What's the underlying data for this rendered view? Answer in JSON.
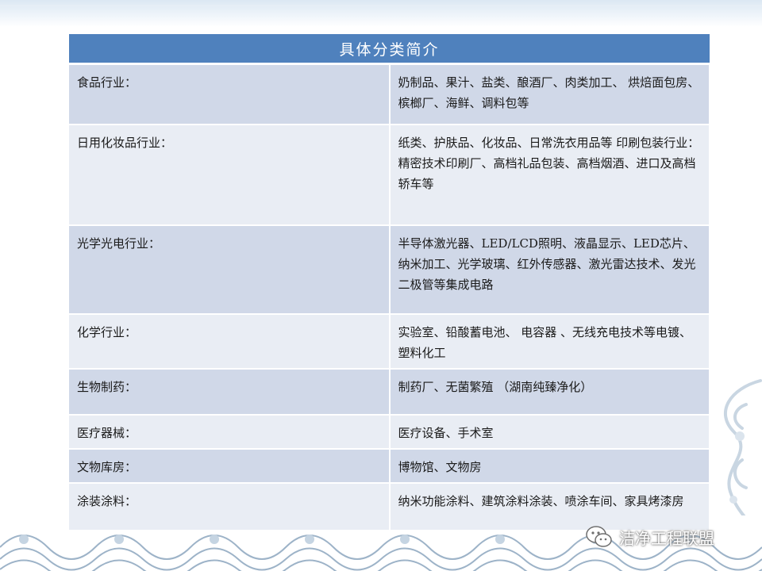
{
  "table": {
    "title": "具体分类简介",
    "rows": [
      {
        "category": "食品行业：",
        "detail": "奶制品、果汁、盐类、酿酒厂、肉类加工、 烘焙面包房、槟榔厂、海鲜、调料包等"
      },
      {
        "category": "日用化妆品行业：",
        "detail": "纸类、护肤品、化妆品、日常洗衣用品等 印刷包装行业：精密技术印刷厂、高档礼品包装、高档烟酒、进口及高档轿车等"
      },
      {
        "category": "光学光电行业：",
        "detail": "半导体激光器、LED/LCD照明、液晶显示、LED芯片、纳米加工、光学玻璃、红外传感器、激光雷达技术、发光二极管等集成电路"
      },
      {
        "category": "化学行业：",
        "detail": "实验室、铅酸蓄电池、 电容器 、无线充电技术等电镀、塑料化工"
      },
      {
        "category": "生物制药：",
        "detail": "制药厂、无菌繁殖 （湖南纯臻净化）"
      },
      {
        "category": "医疗器械：",
        "detail": "医疗设备、手术室"
      },
      {
        "category": "文物库房：",
        "detail": "博物馆、文物房"
      },
      {
        "category": "涂装涂料：",
        "detail": "纳米功能涂料、建筑涂料涂装、喷涂车间、家具烤漆房"
      }
    ]
  },
  "watermark": {
    "text": "洁净工程联盟",
    "icon": "wechat-icon"
  },
  "colors": {
    "header": "#4f81bd",
    "row_dark": "#d0d8e8",
    "row_light": "#e9edf4"
  }
}
